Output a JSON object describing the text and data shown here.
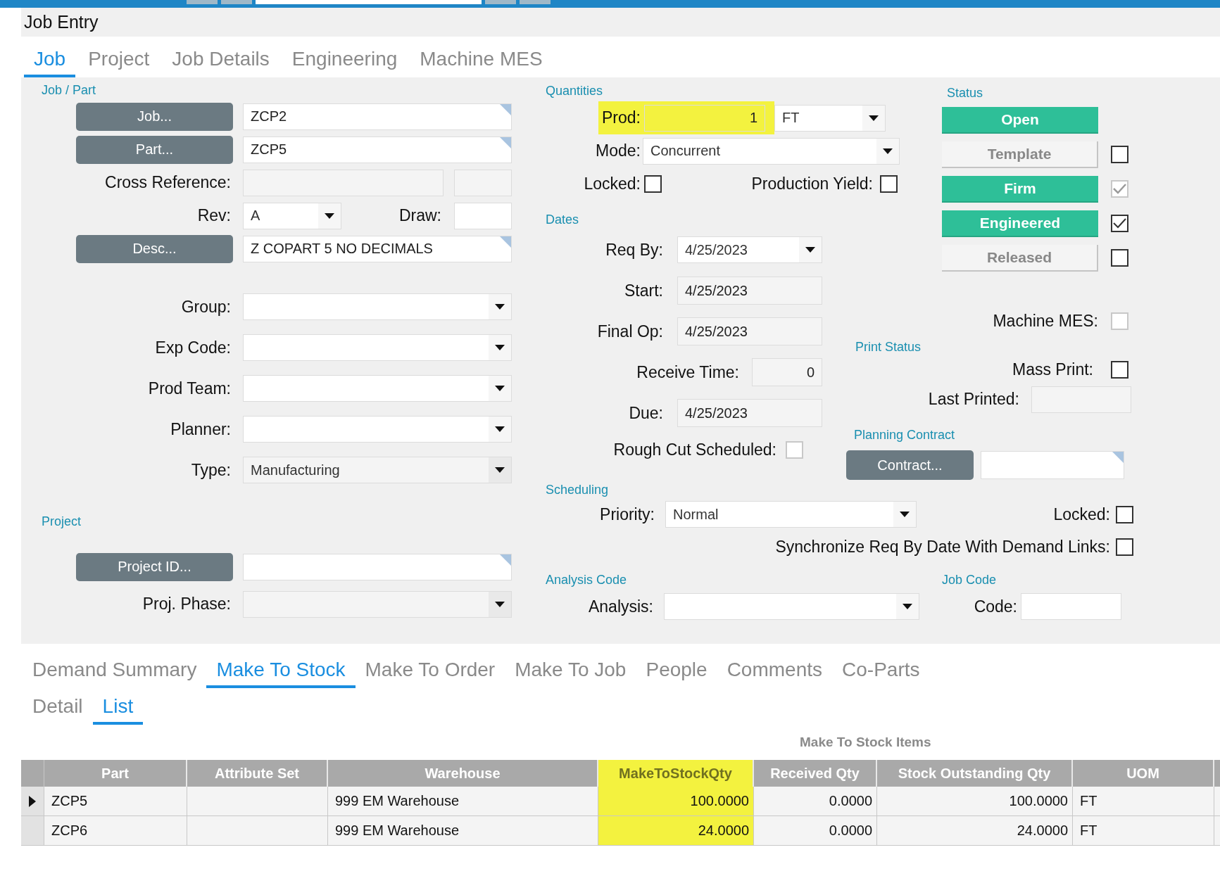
{
  "window": {
    "title": "Job Entry"
  },
  "tabs": [
    {
      "label": "Job",
      "selected": true
    },
    {
      "label": "Project",
      "selected": false
    },
    {
      "label": "Job Details",
      "selected": false
    },
    {
      "label": "Engineering",
      "selected": false
    },
    {
      "label": "Machine MES",
      "selected": false
    }
  ],
  "left_sections": [
    {
      "heading": "Job / Part",
      "rows": [
        {
          "kind": "lookup",
          "button": "Job...",
          "value": "ZCP2"
        },
        {
          "kind": "lookup",
          "button": "Part...",
          "value": "ZCP5"
        },
        {
          "kind": "cross",
          "label": "Cross Reference:"
        },
        {
          "kind": "rev",
          "label": "Rev:",
          "value": "A",
          "label2": "Draw:"
        },
        {
          "kind": "lookup",
          "button": "Desc...",
          "value": "Z COPART 5 NO DECIMALS"
        }
      ]
    },
    {
      "rows": [
        {
          "kind": "combo",
          "label": "Group:",
          "readonly": false
        },
        {
          "kind": "combo",
          "label": "Exp Code:",
          "readonly": false
        },
        {
          "kind": "combo",
          "label": "Prod Team:",
          "readonly": false
        },
        {
          "kind": "combo",
          "label": "Planner:",
          "readonly": false
        },
        {
          "kind": "combo",
          "label": "Type:",
          "value": "Manufacturing",
          "readonly": true
        }
      ]
    },
    {
      "heading": "Project",
      "rows": [
        {
          "kind": "lookup",
          "button": "Project ID..."
        },
        {
          "kind": "combo",
          "label": "Proj. Phase:",
          "readonly": true
        }
      ]
    }
  ],
  "quantities": {
    "heading": "Quantities",
    "prod": {
      "label": "Prod:",
      "value": "1",
      "uom": "FT",
      "highlighted": true
    },
    "mode": {
      "label": "Mode:",
      "value": "Concurrent"
    },
    "locked": {
      "label": "Locked:",
      "checked": false
    },
    "production_yield": {
      "label": "Production Yield:",
      "checked": false
    }
  },
  "dates": {
    "heading": "Dates",
    "rows": [
      {
        "kind": "combo",
        "label": "Req By:",
        "value": "4/25/2023"
      },
      {
        "kind": "readonly",
        "label": "Start:",
        "value": "4/25/2023"
      },
      {
        "kind": "readonly",
        "label": "Final Op:",
        "value": "4/25/2023"
      },
      {
        "kind": "number",
        "label": "Receive Time:",
        "value": "0"
      },
      {
        "kind": "readonly",
        "label": "Due:",
        "value": "4/25/2023"
      }
    ],
    "rough_cut": {
      "label": "Rough Cut Scheduled:",
      "checked": false,
      "disabled": true
    }
  },
  "status": {
    "heading": "Status",
    "items": [
      {
        "label": "Open",
        "on": true
      },
      {
        "label": "Template",
        "on": false,
        "checked": false,
        "disabled": false
      },
      {
        "label": "Firm",
        "on": true,
        "checked": true,
        "disabled": true
      },
      {
        "label": "Engineered",
        "on": true,
        "checked": true,
        "disabled": false
      },
      {
        "label": "Released",
        "on": false,
        "checked": false,
        "disabled": false
      }
    ]
  },
  "machine_mes": {
    "label": "Machine MES:",
    "checked": false,
    "disabled": true
  },
  "print_status": {
    "heading": "Print Status",
    "mass_print": {
      "label": "Mass Print:",
      "checked": false
    },
    "last_printed": {
      "label": "Last Printed:"
    }
  },
  "planning_contract": {
    "heading": "Planning Contract",
    "button": "Contract..."
  },
  "scheduling": {
    "heading": "Scheduling",
    "priority": {
      "label": "Priority:",
      "value": "Normal"
    },
    "locked": {
      "label": "Locked:",
      "checked": false
    },
    "synchronize": {
      "label": "Synchronize Req By Date With Demand Links:",
      "checked": false
    }
  },
  "analysis_code": {
    "heading": "Analysis Code",
    "analysis": {
      "label": "Analysis:"
    }
  },
  "job_code": {
    "heading": "Job Code",
    "code": {
      "label": "Code:"
    }
  },
  "bottom_tabs": [
    {
      "label": "Demand Summary",
      "selected": false
    },
    {
      "label": "Make To Stock",
      "selected": true
    },
    {
      "label": "Make To Order",
      "selected": false
    },
    {
      "label": "Make To Job",
      "selected": false
    },
    {
      "label": "People",
      "selected": false
    },
    {
      "label": "Comments",
      "selected": false
    },
    {
      "label": "Co-Parts",
      "selected": false
    }
  ],
  "sub_tabs": [
    {
      "label": "Detail",
      "selected": false
    },
    {
      "label": "List",
      "selected": true
    }
  ],
  "grid": {
    "title": "Make To Stock Items",
    "columns": [
      {
        "label": "Part",
        "kind": "text",
        "highlighted": false
      },
      {
        "label": "Attribute Set",
        "kind": "text",
        "highlighted": false
      },
      {
        "label": "Warehouse",
        "kind": "text",
        "highlighted": false
      },
      {
        "label": "MakeToStockQty",
        "kind": "number",
        "highlighted": true
      },
      {
        "label": "Received Qty",
        "kind": "number",
        "highlighted": false
      },
      {
        "label": "Stock Outstanding Qty",
        "kind": "number",
        "highlighted": false
      },
      {
        "label": "UOM",
        "kind": "text",
        "highlighted": false
      }
    ],
    "rows": [
      {
        "current": true,
        "cells": [
          "ZCP5",
          "",
          "999 EM Warehouse",
          "100.0000",
          "0.0000",
          "100.0000",
          "FT"
        ]
      },
      {
        "current": false,
        "cells": [
          "ZCP6",
          "",
          "999 EM Warehouse",
          "24.0000",
          "0.0000",
          "24.0000",
          "FT"
        ]
      }
    ]
  }
}
